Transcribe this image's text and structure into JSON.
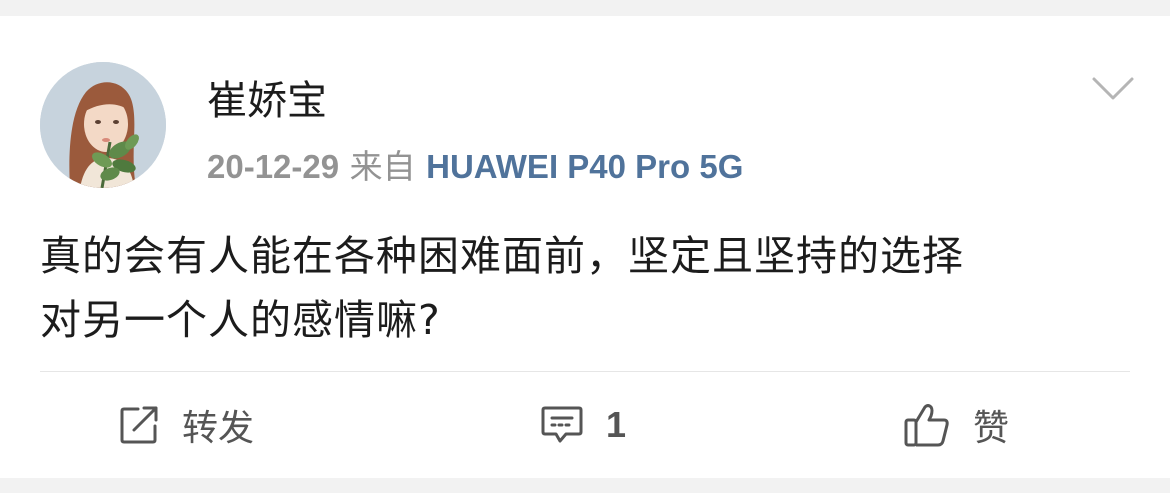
{
  "post": {
    "username": "崔娇宝",
    "date": "20-12-29",
    "source_prefix": "来自",
    "device": "HUAWEI P40 Pro 5G",
    "content_line1": "真的会有人能在各种困难面前，坚定且坚持的选择",
    "content_line2": "对另一个人的感情嘛?"
  },
  "actions": {
    "repost_label": "转发",
    "comment_count": "1",
    "like_label": "赞"
  },
  "icons": {
    "avatar": "avatar-illustration",
    "menu": "chevron-down-icon",
    "repost": "repost-icon",
    "comment": "comment-icon",
    "like": "thumbs-up-icon"
  },
  "colors": {
    "source_link": "#50739b",
    "text": "#1c1c1c",
    "muted": "#939393"
  }
}
